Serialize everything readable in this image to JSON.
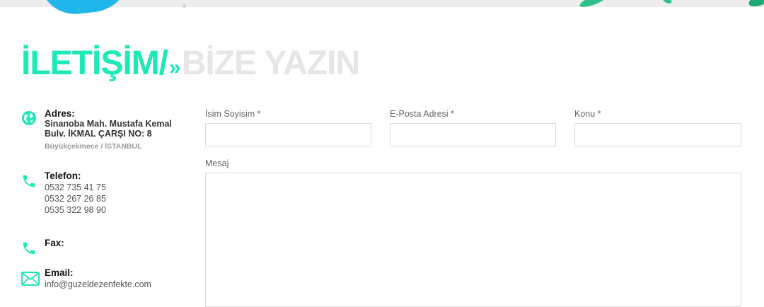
{
  "heading": {
    "main": "İLETİŞİM",
    "slash": "/",
    "chevron": "»",
    "sub": "BİZE YAZIN"
  },
  "contact": {
    "address": {
      "icon": "globe-icon",
      "title": "Adres:",
      "line1": "Sinanoba Mah. Mustafa Kemal",
      "line2": "Bulv. İKMAL ÇARŞI NO: 8",
      "line3": "Büyükçekmece / İSTANBUL"
    },
    "phone": {
      "icon": "phone-icon",
      "title": "Telefon:",
      "numbers": [
        "0532 735 41 75",
        "0532 267 26 85",
        "0535 322 98 90"
      ]
    },
    "fax": {
      "icon": "phone-icon",
      "title": "Fax:"
    },
    "email": {
      "icon": "envelope-icon",
      "title": "Email:",
      "value": "info@guzeldezenfekte.com"
    }
  },
  "form": {
    "name_label": "İsim Soyisim *",
    "email_label": "E-Posta Adresi *",
    "subject_label": "Konu *",
    "message_label": "Mesaj"
  },
  "colors": {
    "accent": "#1de9b6",
    "heading_muted": "#e6e6e6",
    "blob_blue": "#1fb7ea"
  }
}
